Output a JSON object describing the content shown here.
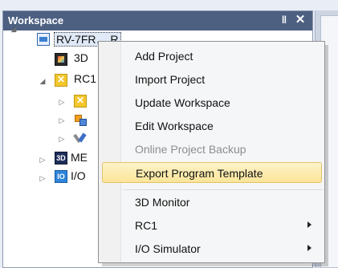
{
  "panel": {
    "title": "Workspace",
    "pin_glyph": "‖",
    "close_glyph": "✕"
  },
  "tree": {
    "items": [
      {
        "label": "RV-7FR… R",
        "icon": "project-icon",
        "expander": "◢",
        "selected": true
      },
      {
        "label": "3D",
        "icon": "3d-monitor-icon"
      },
      {
        "label": "RC1",
        "icon": "rc-controller-icon",
        "expander": "◢"
      },
      {
        "label": "",
        "icon": "rc-subfolder-icon",
        "expander": "▷"
      },
      {
        "label": "",
        "icon": "parameter-blocks-icon",
        "expander": "▷"
      },
      {
        "label": "",
        "icon": "tools-icon",
        "expander": "▷"
      },
      {
        "label": "ME",
        "icon": "me-3d-icon",
        "icon_text": "3D",
        "expander": "▷"
      },
      {
        "label": "I/O",
        "icon": "io-simulator-icon",
        "icon_text": "IO",
        "expander": "▷"
      }
    ]
  },
  "context_menu": {
    "items": [
      {
        "label": "Add Project",
        "state": "normal"
      },
      {
        "label": "Import Project",
        "state": "normal"
      },
      {
        "label": "Update Workspace",
        "state": "normal"
      },
      {
        "label": "Edit Workspace",
        "state": "normal"
      },
      {
        "label": "Online Project Backup",
        "state": "disabled"
      },
      {
        "label": "Export Program Template",
        "state": "highlighted"
      },
      {
        "label": "3D Monitor",
        "state": "normal"
      },
      {
        "label": "RC1",
        "state": "normal",
        "submenu": true
      },
      {
        "label": "I/O Simulator",
        "state": "normal",
        "submenu": true
      }
    ]
  },
  "colors": {
    "panel_header": "#4d6082",
    "highlight": "#fbe59a",
    "disabled_text": "#8d8d8d"
  }
}
